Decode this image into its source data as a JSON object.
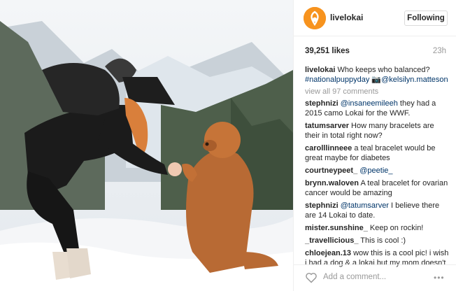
{
  "account": {
    "username": "livelokai",
    "follow_label": "Following"
  },
  "post": {
    "likes": "39,251 likes",
    "time": "23h"
  },
  "caption": {
    "user": "livelokai",
    "text": " Who keeps who balanced? ",
    "tags": "#nationalpuppyday",
    "mention": "📷@kelsilyn.matteson"
  },
  "view_all": "view all 97 comments",
  "comments": [
    {
      "user": "stephnizi",
      "mention": "@insaneemileeh",
      "text": " they had a 2015 camo Lokai for the WWF."
    },
    {
      "user": "tatumsarver",
      "mention": "",
      "text": " How many bracelets are their in total right now?"
    },
    {
      "user": "carolllinneee",
      "mention": "",
      "text": " a teal bracelet would be great maybe for diabetes"
    },
    {
      "user": "courtneypeet_",
      "mention": "@peetie_",
      "text": ""
    },
    {
      "user": "brynn.waloven",
      "mention": "",
      "text": " A teal bracelet for ovarian cancer would be amazing"
    },
    {
      "user": "stephnizi",
      "mention": "@tatumsarver",
      "text": " I believe there are 14 Lokai to date."
    },
    {
      "user": "mister.sunshine_",
      "mention": "",
      "text": " Keep on rockin!"
    },
    {
      "user": "_travellicious_",
      "mention": "",
      "text": " This is cool :)"
    },
    {
      "user": "chloejean.13",
      "mention": "",
      "text": " wow this is a cool pic! i wish i had a dog & a lokai but my mom doesn't"
    }
  ],
  "add_comment": "Add a comment...",
  "more": "•••",
  "colors": {
    "accent": "#f7931e",
    "link": "#003569"
  }
}
